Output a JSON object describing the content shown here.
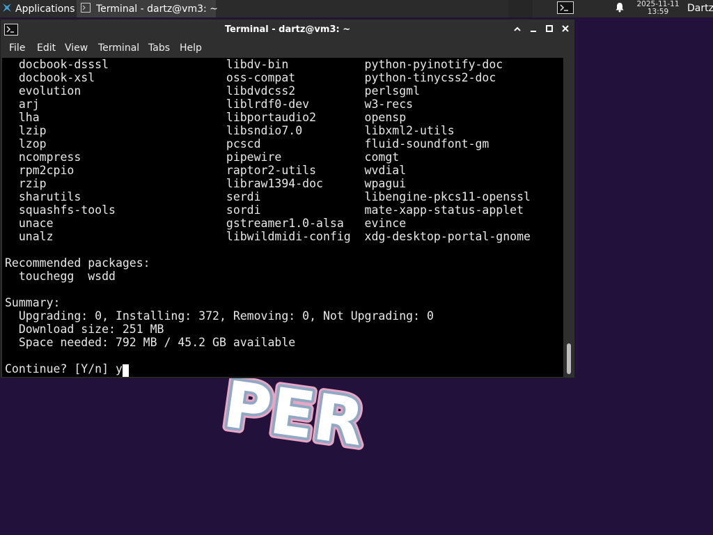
{
  "panel": {
    "applications_label": "Applications",
    "task_label": "Terminal - dartz@vm3: ~",
    "clock_date": "2025-11-11",
    "clock_time": "13:59",
    "user": "Dartz"
  },
  "window": {
    "title": "Terminal - dartz@vm3: ~",
    "controls": {
      "up": "⌃",
      "minimize": "—",
      "maximize": "◻",
      "close": "✕"
    }
  },
  "menu": [
    "File",
    "Edit",
    "View",
    "Terminal",
    "Tabs",
    "Help"
  ],
  "terminal": {
    "package_rows": [
      [
        "docbook-dsssl",
        "libdv-bin",
        "python-pyinotify-doc"
      ],
      [
        "docbook-xsl",
        "oss-compat",
        "python-tinycss2-doc"
      ],
      [
        "evolution",
        "libdvdcss2",
        "perlsgml"
      ],
      [
        "arj",
        "liblrdf0-dev",
        "w3-recs"
      ],
      [
        "lha",
        "libportaudio2",
        "opensp"
      ],
      [
        "lzip",
        "libsndio7.0",
        "libxml2-utils"
      ],
      [
        "lzop",
        "pcscd",
        "fluid-soundfont-gm"
      ],
      [
        "ncompress",
        "pipewire",
        "comgt"
      ],
      [
        "rpm2cpio",
        "raptor2-utils",
        "wvdial"
      ],
      [
        "rzip",
        "libraw1394-doc",
        "wpagui"
      ],
      [
        "sharutils",
        "serdi",
        "libengine-pkcs11-openssl"
      ],
      [
        "squashfs-tools",
        "sordi",
        "mate-xapp-status-applet"
      ],
      [
        "unace",
        "gstreamer1.0-alsa",
        "evince"
      ],
      [
        "unalz",
        "libwildmidi-config",
        "xdg-desktop-portal-gnome"
      ]
    ],
    "recommended_header": "Recommended packages:",
    "recommended_list": "touchegg  wsdd",
    "summary_header": "Summary:",
    "summary_lines": [
      "Upgrading: 0, Installing: 372, Removing: 0, Not Upgrading: 0",
      "Download size: 251 MB",
      "Space needed: 792 MB / 45.2 GB available"
    ],
    "prompt": "Continue? [Y/n] ",
    "typed": "y"
  },
  "scroll_position": 0.95,
  "logo_text": "PER"
}
